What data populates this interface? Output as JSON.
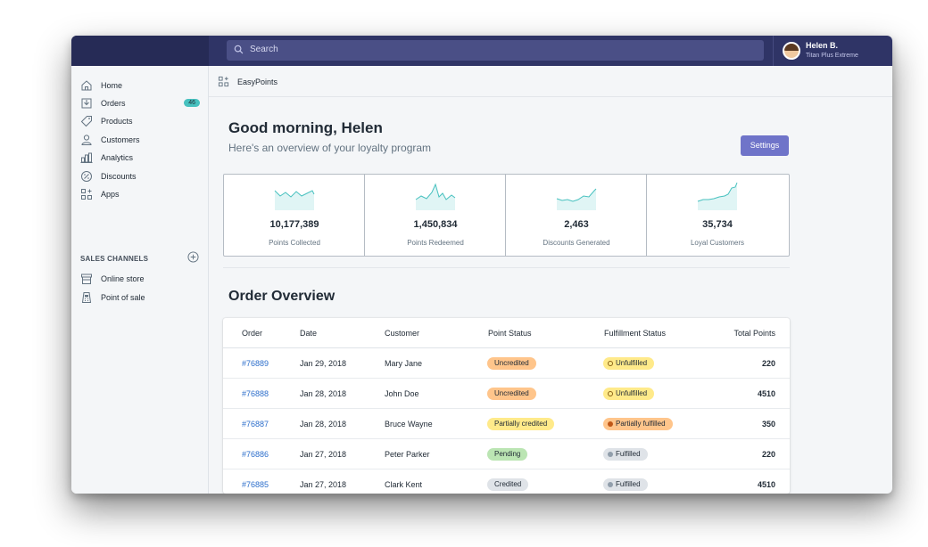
{
  "topbar": {
    "search_placeholder": "Search",
    "user_name": "Helen B.",
    "user_plan": "Titan Plus Extreme"
  },
  "sidebar": {
    "items": [
      {
        "label": "Home",
        "icon": "home-icon"
      },
      {
        "label": "Orders",
        "icon": "orders-icon",
        "badge": "46"
      },
      {
        "label": "Products",
        "icon": "tag-icon"
      },
      {
        "label": "Customers",
        "icon": "person-icon"
      },
      {
        "label": "Analytics",
        "icon": "bar-chart-icon"
      },
      {
        "label": "Discounts",
        "icon": "discount-icon"
      },
      {
        "label": "Apps",
        "icon": "apps-icon"
      }
    ],
    "channels_title": "SALES CHANNELS",
    "channels": [
      {
        "label": "Online store",
        "icon": "store-icon"
      },
      {
        "label": "Point of sale",
        "icon": "pos-icon"
      }
    ]
  },
  "appbar": {
    "app_name": "EasyPoints"
  },
  "dashboard": {
    "greeting": "Good morning, Helen",
    "subtitle": "Here's an overview of your loyalty program",
    "settings_label": "Settings"
  },
  "stats": [
    {
      "value": "10,177,389",
      "label": "Points Collected"
    },
    {
      "value": "1,450,834",
      "label": "Points Redeemed"
    },
    {
      "value": "2,463",
      "label": "Discounts Generated"
    },
    {
      "value": "35,734",
      "label": "Loyal Customers"
    }
  ],
  "orders": {
    "title": "Order Overview",
    "columns": [
      "Order",
      "Date",
      "Customer",
      "Point Status",
      "Fulfillment Status",
      "Total Points"
    ],
    "rows": [
      {
        "order": "#76889",
        "date": "Jan 29, 2018",
        "customer": "Mary Jane",
        "point_status": "Uncredited",
        "fulfillment": "Unfulfilled",
        "total": "220"
      },
      {
        "order": "#76888",
        "date": "Jan 28, 2018",
        "customer": "John Doe",
        "point_status": "Uncredited",
        "fulfillment": "Unfulfilled",
        "total": "4510"
      },
      {
        "order": "#76887",
        "date": "Jan 28, 2018",
        "customer": "Bruce Wayne",
        "point_status": "Partially credited",
        "fulfillment": "Partially fulfilled",
        "total": "350"
      },
      {
        "order": "#76886",
        "date": "Jan 27, 2018",
        "customer": "Peter Parker",
        "point_status": "Pending",
        "fulfillment": "Fulfilled",
        "total": "220"
      },
      {
        "order": "#76885",
        "date": "Jan 27, 2018",
        "customer": "Clark Kent",
        "point_status": "Credited",
        "fulfillment": "Fulfilled",
        "total": "4510"
      }
    ]
  },
  "colors": {
    "topbar": "#2f3466",
    "accent": "#6f74c9",
    "link": "#2c6ecb",
    "badge_teal": "#47c1bf",
    "status_orange": "#ffc58b",
    "status_yellow": "#ffea8a",
    "status_green": "#bbe5b3",
    "status_gray": "#dfe3e8",
    "sparkline": "#47c1bf"
  }
}
